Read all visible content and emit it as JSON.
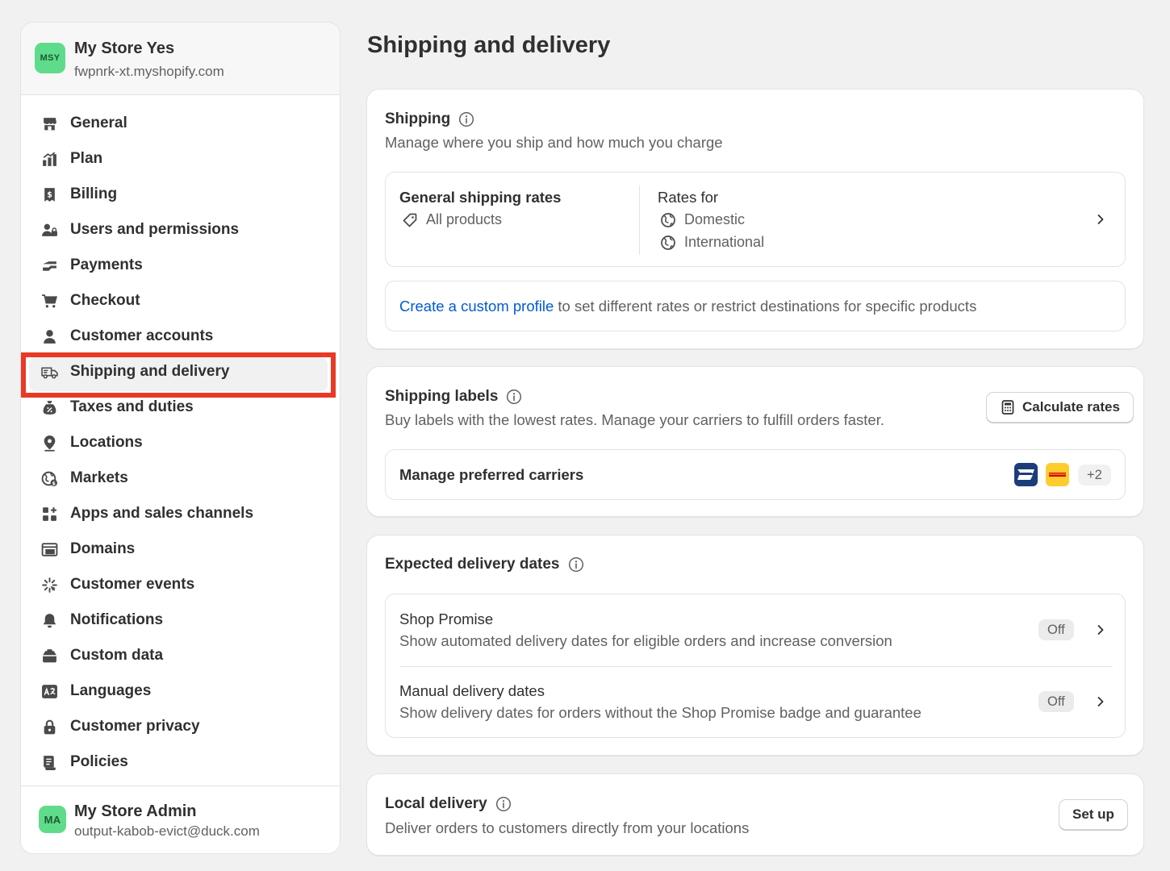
{
  "store": {
    "initials": "MSY",
    "name": "My Store Yes",
    "domain": "fwpnrk-xt.myshopify.com"
  },
  "nav": {
    "items": [
      {
        "label": "General",
        "icon": "store-icon"
      },
      {
        "label": "Plan",
        "icon": "plan-icon"
      },
      {
        "label": "Billing",
        "icon": "billing-icon"
      },
      {
        "label": "Users and permissions",
        "icon": "users-icon"
      },
      {
        "label": "Payments",
        "icon": "payments-icon"
      },
      {
        "label": "Checkout",
        "icon": "cart-icon"
      },
      {
        "label": "Customer accounts",
        "icon": "person-icon"
      },
      {
        "label": "Shipping and delivery",
        "icon": "truck-icon"
      },
      {
        "label": "Taxes and duties",
        "icon": "tax-icon"
      },
      {
        "label": "Locations",
        "icon": "location-pin-icon"
      },
      {
        "label": "Markets",
        "icon": "globe-icon"
      },
      {
        "label": "Apps and sales channels",
        "icon": "apps-icon"
      },
      {
        "label": "Domains",
        "icon": "domains-icon"
      },
      {
        "label": "Customer events",
        "icon": "sparkle-icon"
      },
      {
        "label": "Notifications",
        "icon": "bell-icon"
      },
      {
        "label": "Custom data",
        "icon": "database-icon"
      },
      {
        "label": "Languages",
        "icon": "translate-icon"
      },
      {
        "label": "Customer privacy",
        "icon": "lock-icon"
      },
      {
        "label": "Policies",
        "icon": "policies-icon"
      }
    ],
    "active": "Shipping and delivery",
    "highlight_color": "#e83a24"
  },
  "admin": {
    "initials": "MA",
    "name": "My Store Admin",
    "email": "output-kabob-evict@duck.com"
  },
  "page": {
    "title": "Shipping and delivery"
  },
  "shipping": {
    "title": "Shipping",
    "description": "Manage where you ship and how much you charge",
    "general_rates_title": "General shipping rates",
    "all_products": "All products",
    "rates_for": "Rates for",
    "domestic": "Domestic",
    "international": "International",
    "custom_link": "Create a custom profile",
    "custom_rest": " to set different rates or restrict destinations for specific products"
  },
  "labels": {
    "title": "Shipping labels",
    "description": "Buy labels with the lowest rates. Manage your carriers to fulfill orders faster.",
    "calculate_button": "Calculate rates",
    "carriers_label": "Manage preferred carriers",
    "carriers_more": "+2",
    "carrier_logos": [
      "usps-logo",
      "dhl-logo"
    ]
  },
  "delivery_dates": {
    "title": "Expected delivery dates",
    "rows": [
      {
        "title": "Shop Promise",
        "desc": "Show automated delivery dates for eligible orders and increase conversion",
        "status": "Off"
      },
      {
        "title": "Manual delivery dates",
        "desc": "Show delivery dates for orders without the Shop Promise badge and guarantee",
        "status": "Off"
      }
    ]
  },
  "local_delivery": {
    "title": "Local delivery",
    "description": "Deliver orders to customers directly from your locations",
    "setup_button": "Set up"
  },
  "colors": {
    "link": "#005bd3",
    "background": "#f1f1f1",
    "avatar": "#5fdc8b"
  }
}
